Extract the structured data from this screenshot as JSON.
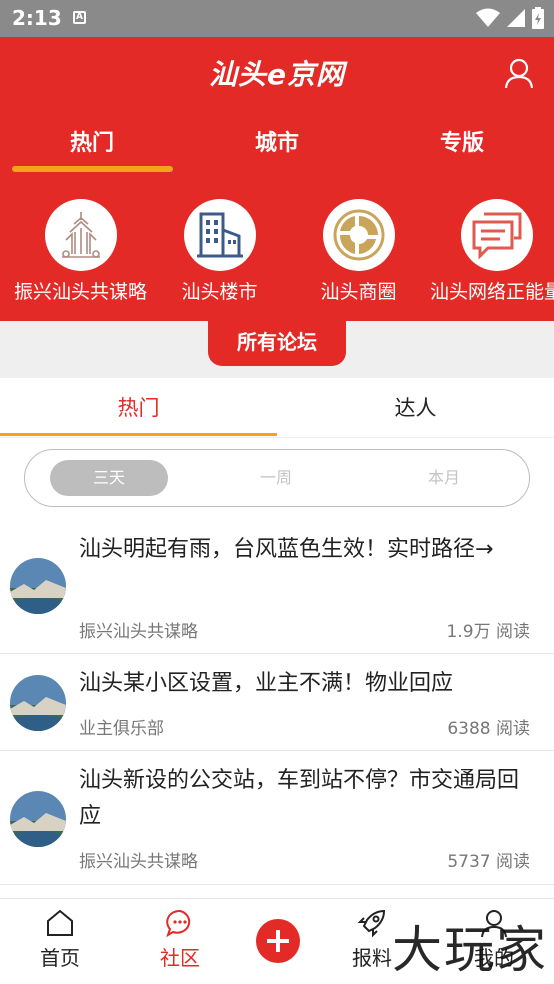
{
  "status_bar": {
    "time": "2:13",
    "notification_icon": "a-icon",
    "icons": [
      "wifi-icon",
      "signal-icon",
      "battery-icon"
    ]
  },
  "header": {
    "logo": "汕头e京网",
    "user_icon": "user-icon",
    "tabs": [
      {
        "label": "热门",
        "active": true
      },
      {
        "label": "城市",
        "active": false
      },
      {
        "label": "专版",
        "active": false
      }
    ],
    "forums": [
      {
        "label": "振兴汕头共谋略",
        "icon": "monument-icon"
      },
      {
        "label": "汕头楼市",
        "icon": "building-icon"
      },
      {
        "label": "汕头商圈",
        "icon": "ring-chart-icon"
      },
      {
        "label": "汕头网络正能量",
        "icon": "chat-bubbles-icon"
      }
    ],
    "all_forums": "所有论坛"
  },
  "sub_tabs": [
    {
      "label": "热门",
      "active": true
    },
    {
      "label": "达人",
      "active": false
    }
  ],
  "time_filter": [
    {
      "label": "三天",
      "selected": true
    },
    {
      "label": "一周",
      "selected": false
    },
    {
      "label": "本月",
      "selected": false
    }
  ],
  "posts": [
    {
      "title": "汕头明起有雨，台风蓝色生效！实时路径→",
      "forum": "振兴汕头共谋略",
      "reads": "1.9万 阅读"
    },
    {
      "title": "汕头某小区设置，业主不满！物业回应",
      "forum": "业主俱乐部",
      "reads": "6388 阅读"
    },
    {
      "title": "汕头新设的公交站，车到站不停？市交通局回应",
      "forum": "振兴汕头共谋略",
      "reads": "5737 阅读"
    }
  ],
  "bottom_nav": [
    {
      "label": "首页",
      "icon": "home-icon",
      "active": false
    },
    {
      "label": "社区",
      "icon": "chat-icon",
      "active": true
    },
    {
      "label": "",
      "icon": "add-icon",
      "active": false
    },
    {
      "label": "报料",
      "icon": "rocket-icon",
      "active": false
    },
    {
      "label": "我的",
      "icon": "user-icon",
      "active": false
    }
  ],
  "watermark": "大玩家",
  "colors": {
    "brand_red": "#e32a27",
    "accent_orange": "#f7a21b",
    "muted_text": "#777777"
  }
}
